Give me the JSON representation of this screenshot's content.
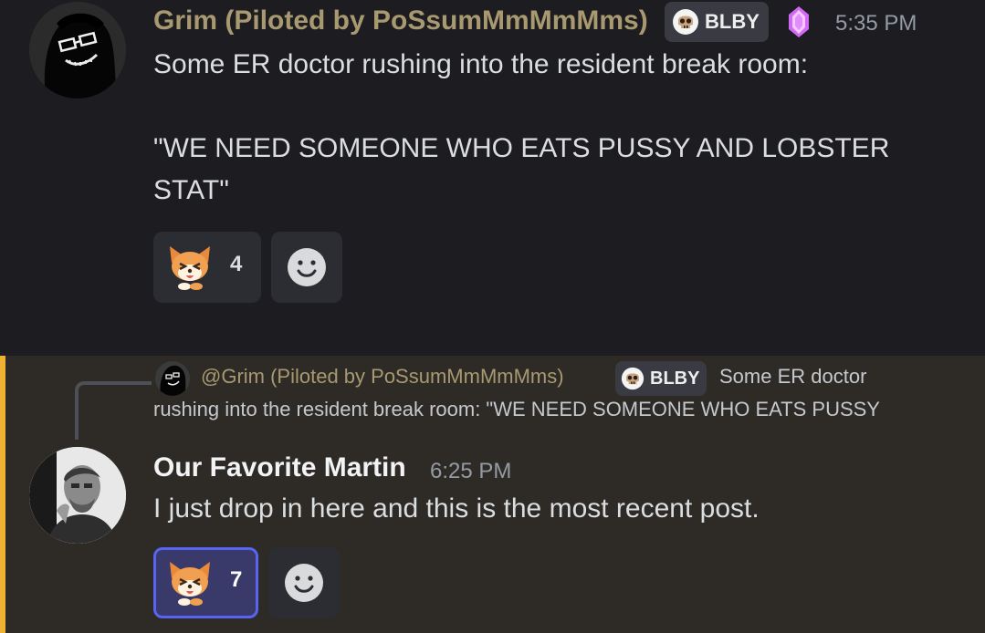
{
  "colors": {
    "username_grim": "#a89970",
    "username_martin": "#f2f3f5",
    "timestamp": "#949ba4",
    "highlight_bar": "#f0b232",
    "reaction_active_border": "#5865f2"
  },
  "message1": {
    "author": "Grim (Piloted by PoSsumMmMmMms)",
    "tag": "BLBY",
    "tag_icon": "skull-icon",
    "badge_icon": "purple-gem-icon",
    "timestamp": "5:35 PM",
    "lines": [
      "Some ER doctor rushing into the resident break room:",
      "\"WE NEED SOMEONE WHO EATS PUSSY AND LOBSTER",
      "STAT\""
    ],
    "reaction": {
      "emoji": "shiba-dog-emoji",
      "count": "4",
      "active": false
    },
    "add_reaction_icon": "add-reaction-icon"
  },
  "message2": {
    "reply": {
      "author": "@Grim (Piloted by PoSsumMmMmMms)",
      "tag": "BLBY",
      "text_line1": "Some ER doctor",
      "text_line2": "rushing into the resident break room:  \"WE NEED SOMEONE WHO EATS PUSSY"
    },
    "author": "Our Favorite Martin",
    "timestamp": "6:25 PM",
    "content": "I just drop in here and this is the most recent post.",
    "reaction": {
      "emoji": "shiba-dog-emoji",
      "count": "7",
      "active": true
    },
    "add_reaction_icon": "add-reaction-icon"
  }
}
